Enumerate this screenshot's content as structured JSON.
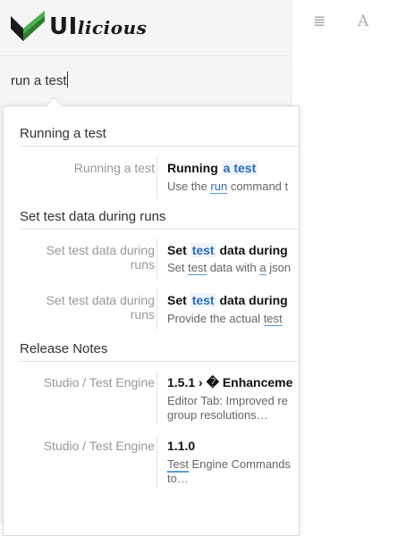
{
  "logo": {
    "text_main": "UI",
    "text_script": "licious"
  },
  "search": {
    "value": "run a test"
  },
  "toolbar": {
    "list_icon": "≣",
    "font_icon": "A"
  },
  "results": {
    "cat1": {
      "title": "Running a test",
      "hit1": {
        "lvl": "Running a test",
        "title_a": "Running ",
        "title_b": "a test",
        "snip_a": "Use the ",
        "snip_b": "run",
        "snip_c": " command t"
      }
    },
    "cat2": {
      "title": "Set test data during runs",
      "hit1": {
        "lvl": "Set test data during runs",
        "title_a": "Set ",
        "title_b": "test",
        "title_c": " data during",
        "snip_a": "Set ",
        "snip_b": "test",
        "snip_c": " data with ",
        "snip_d": "a",
        "snip_e": " json"
      },
      "hit2": {
        "lvl": "Set test data during runs",
        "title_a": "Set ",
        "title_b": "test",
        "title_c": " data during",
        "snip_a": "Provide the actual ",
        "snip_b": "test"
      }
    },
    "cat3": {
      "title": "Release Notes",
      "hit1": {
        "lvl": "Studio / Test Engine",
        "title": "1.5.1 › � Enhanceme",
        "snip_line1": "Editor Tab: Improved re",
        "snip_line2": "group resolutions…"
      },
      "hit2": {
        "lvl": "Studio / Test Engine",
        "title": "1.1.0",
        "snip_a": "Test",
        "snip_b": " Engine Commands",
        "snip_line2": "to…"
      }
    }
  }
}
